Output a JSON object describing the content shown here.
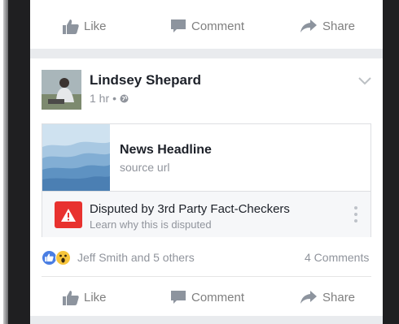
{
  "top_actions": {
    "like_label": "Like",
    "comment_label": "Comment",
    "share_label": "Share"
  },
  "post": {
    "author": "Lindsey Shepard",
    "time": "1 hr",
    "separator": "•",
    "link": {
      "headline": "News Headline",
      "source": "source url"
    },
    "dispute": {
      "title": "Disputed by 3rd Party Fact-Checkers",
      "subtitle": "Learn why this is disputed"
    },
    "reactions": {
      "names": "Jeff Smith and 5 others",
      "comments": "4 Comments"
    },
    "actions": {
      "like_label": "Like",
      "comment_label": "Comment",
      "share_label": "Share"
    }
  },
  "colors": {
    "warning_red": "#e8322f",
    "like_blue": "#4a7ee3",
    "action_gray": "#7f7f7f"
  }
}
